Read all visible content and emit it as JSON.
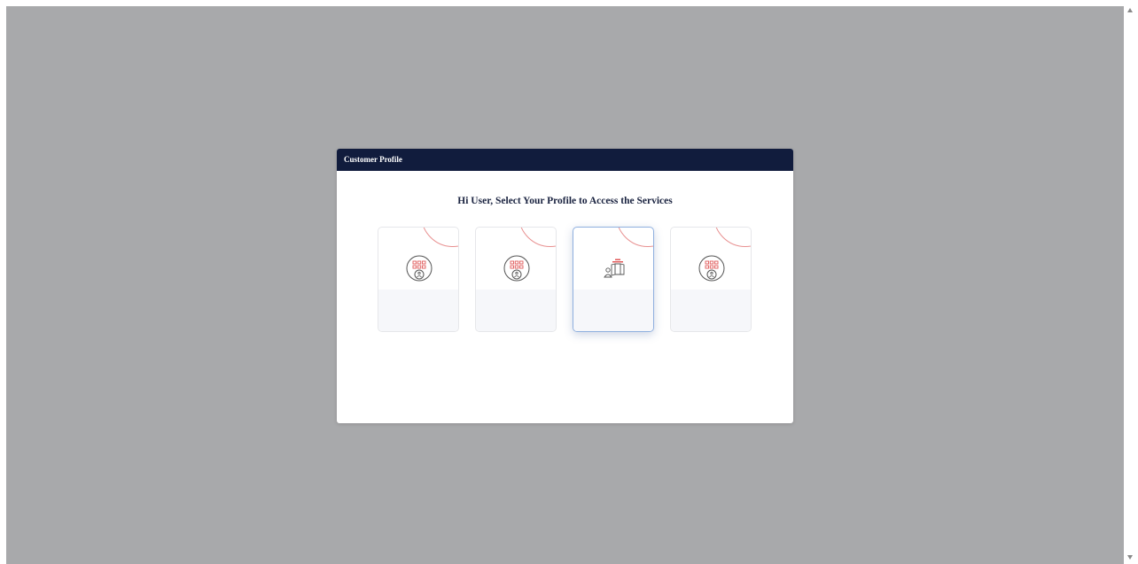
{
  "modal": {
    "title": "Customer Profile",
    "heading": "Hi User, Select Your Profile to Access the Services"
  },
  "profile_cards": [
    {
      "icon": "building-icon",
      "label": "",
      "selected": false
    },
    {
      "icon": "building-icon",
      "label": "",
      "selected": false
    },
    {
      "icon": "user-documents-icon",
      "label": "",
      "selected": true
    },
    {
      "icon": "building-icon",
      "label": "",
      "selected": false
    }
  ],
  "colors": {
    "header_bg": "#111c3d",
    "overlay": "#a8a9ab",
    "accent_red": "#e05a5a",
    "selected_border": "#8fb0df"
  }
}
